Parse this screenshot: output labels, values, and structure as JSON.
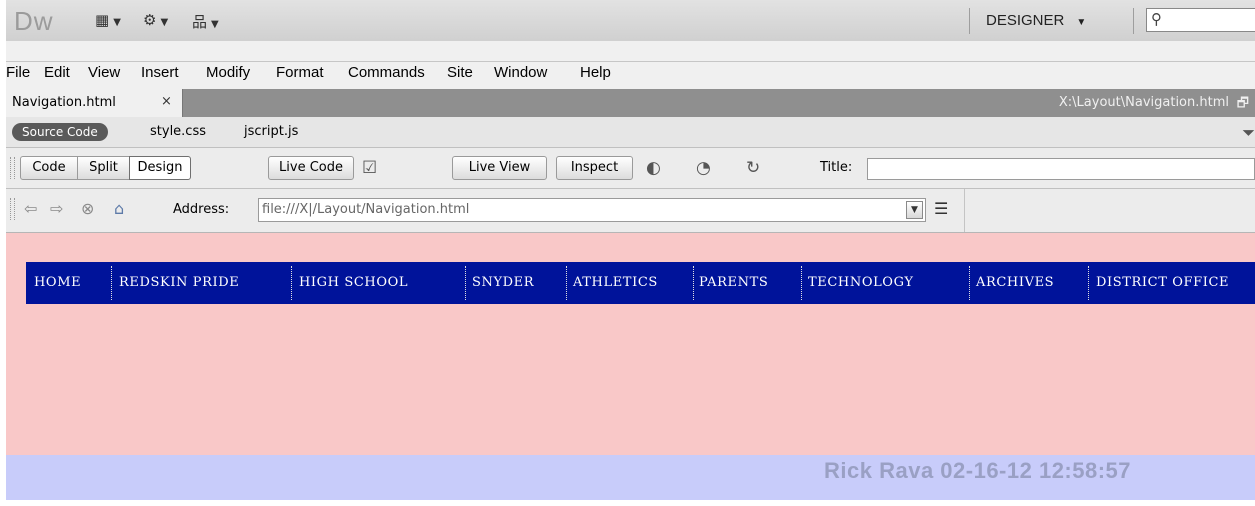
{
  "app": {
    "logo": "Dw",
    "workspace": "DESIGNER",
    "search_placeholder": ""
  },
  "menu": [
    "File",
    "Edit",
    "View",
    "Insert",
    "Modify",
    "Format",
    "Commands",
    "Site",
    "Window",
    "Help"
  ],
  "document": {
    "tab_label": "Navigation.html",
    "close_glyph": "×",
    "path": "X:\\Layout\\Navigation.html"
  },
  "related_files": {
    "source": "Source Code",
    "files": [
      "style.css",
      "jscript.js"
    ]
  },
  "doc_toolbar": {
    "views": [
      "Code",
      "Split",
      "Design"
    ],
    "active_view": "Design",
    "live_code": "Live Code",
    "live_view": "Live View",
    "inspect": "Inspect",
    "title_label": "Title:",
    "title_value": ""
  },
  "browser_toolbar": {
    "address_label": "Address:",
    "address_value": "file:///X|/Layout/Navigation.html"
  },
  "page": {
    "nav_items": [
      "HOME",
      "REDSKIN PRIDE",
      "HIGH SCHOOL",
      "SNYDER",
      "ATHLETICS",
      "PARENTS",
      "TECHNOLOGY",
      "ARCHIVES",
      "DISTRICT OFFICE"
    ],
    "footer": "Rick Rava 02-16-12 12:58:57"
  },
  "colors": {
    "nav_background": "#00139a",
    "canvas_background": "#f9c8c8",
    "footer_background": "#c8ccfa"
  }
}
